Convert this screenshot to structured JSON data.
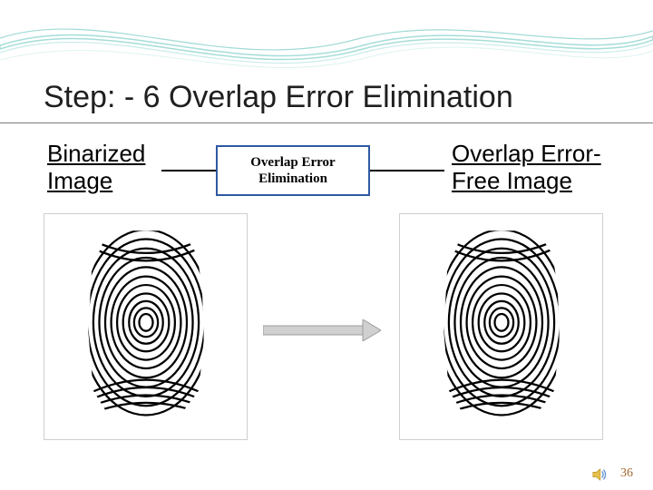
{
  "slide": {
    "title": "Step: - 6 Overlap Error Elimination",
    "label_left": "Binarized\nImage",
    "process_box": "Overlap Error\nElimination",
    "label_right": "Overlap Error-\nFree Image",
    "page_number": "36",
    "image_left_alt": "binarized fingerprint image",
    "image_right_alt": "overlap-error-free fingerprint image"
  },
  "icons": {
    "sound": "sound-icon"
  }
}
